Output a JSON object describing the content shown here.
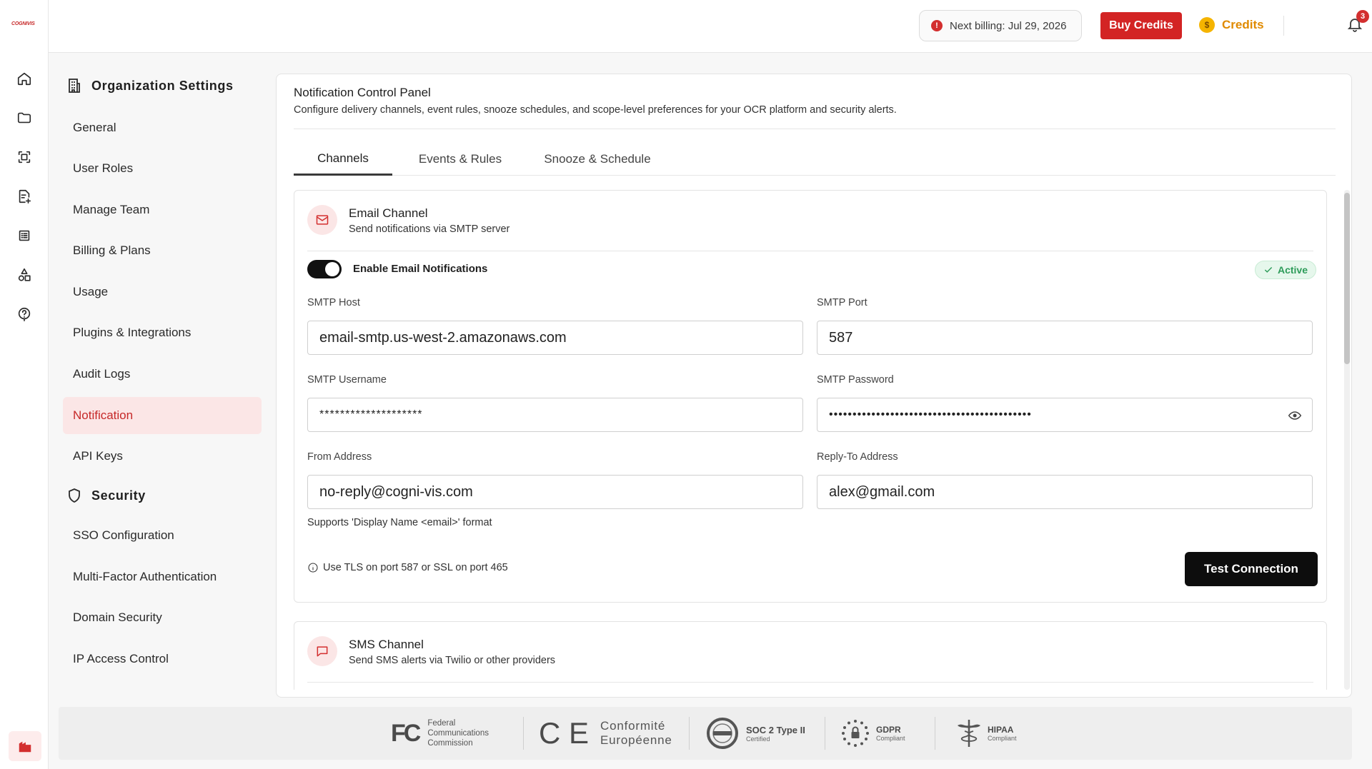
{
  "brand": {
    "logo_text": "COGNIVIS"
  },
  "rail": {
    "items": [
      "home",
      "folder",
      "scan",
      "document-add",
      "list",
      "shapes",
      "help"
    ]
  },
  "topbar": {
    "billing_text": "Next billing: Jul 29, 2026",
    "buy_credits_label": "Buy Credits",
    "credits_label": "Credits",
    "notification_count": "3"
  },
  "settings_nav": {
    "org_heading": "Organization Settings",
    "org_items": [
      "General",
      "User Roles",
      "Manage Team",
      "Billing & Plans",
      "Usage",
      "Plugins & Integrations",
      "Audit Logs",
      "Notification",
      "API Keys"
    ],
    "active_item": "Notification",
    "security_heading": "Security",
    "security_items": [
      "SSO Configuration",
      "Multi-Factor Authentication",
      "Domain Security",
      "IP Access Control"
    ]
  },
  "panel": {
    "title": "Notification Control Panel",
    "subtitle": "Configure delivery channels, event rules, snooze schedules, and scope-level preferences for your OCR platform and security alerts.",
    "tabs": [
      "Channels",
      "Events & Rules",
      "Snooze & Schedule"
    ],
    "active_tab": "Channels"
  },
  "email_channel": {
    "title": "Email Channel",
    "subtitle": "Send notifications via SMTP server",
    "toggle_label": "Enable Email Notifications",
    "toggle_on": true,
    "status": "Active",
    "smtp_host_label": "SMTP Host",
    "smtp_host_value": "email-smtp.us-west-2.amazonaws.com",
    "smtp_port_label": "SMTP Port",
    "smtp_port_value": "587",
    "smtp_username_label": "SMTP Username",
    "smtp_username_value": "********************",
    "smtp_password_label": "SMTP Password",
    "smtp_password_value": "•••••••••••••••••••••••••••••••••••••••••••",
    "from_label": "From Address",
    "from_value": "no-reply@cogni-vis.com",
    "from_hint": "Supports 'Display Name <email>' format",
    "reply_to_label": "Reply-To Address",
    "reply_to_value": "alex@gmail.com",
    "tls_note": "Use TLS on port 587 or SSL on port 465",
    "test_button_label": "Test Connection"
  },
  "sms_channel": {
    "title": "SMS Channel",
    "subtitle": "Send SMS alerts via Twilio or other providers"
  },
  "footer": {
    "fcc_mark": "FC",
    "fcc_lines": [
      "Federal",
      "Communications",
      "Commission"
    ],
    "ce_mark": "C E",
    "ce_lines": [
      "Conformité",
      "Européenne"
    ],
    "soc_title": "SOC 2 Type II",
    "soc_sub": "Certified",
    "gdpr_title": "GDPR",
    "gdpr_sub": "Compliant",
    "hipaa_title": "HIPAA",
    "hipaa_sub": "Compliant"
  },
  "colors": {
    "accent": "#d32424",
    "active_nav_bg": "#fbe6e6",
    "success": "#2e9c5a",
    "credits": "#e08a00"
  }
}
